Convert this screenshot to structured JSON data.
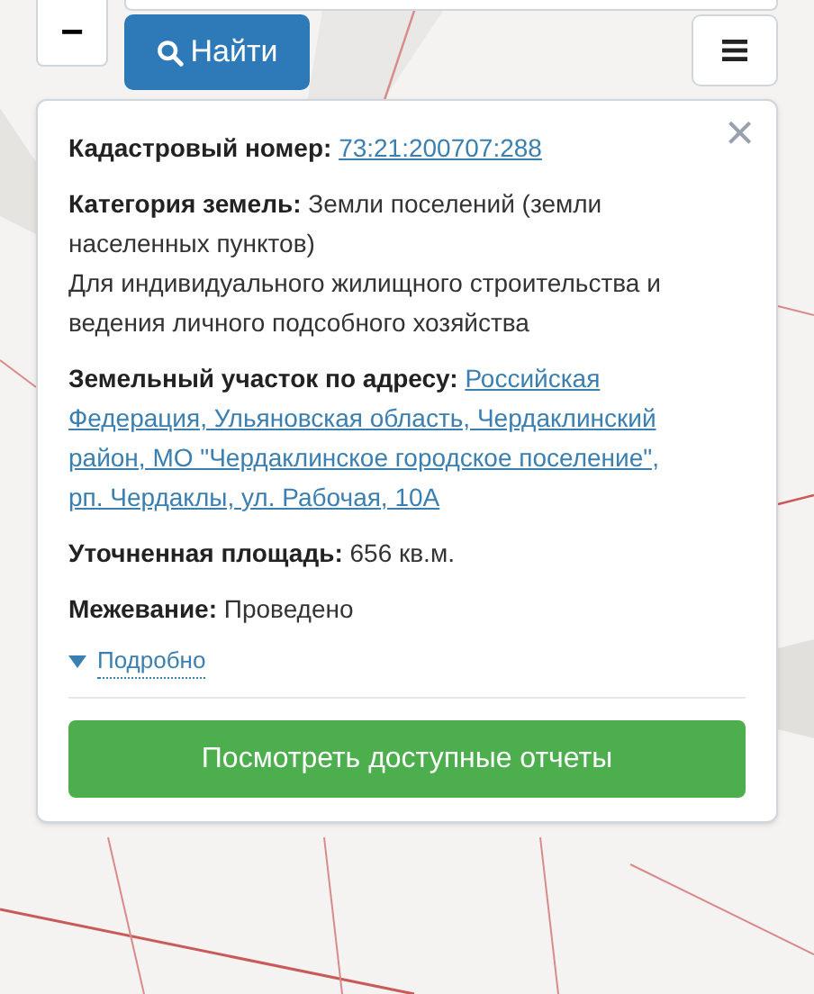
{
  "map_controls": {
    "zoom_out": "−",
    "search_button": "Найти"
  },
  "popup": {
    "close": "×",
    "fields": [
      {
        "kind": "link",
        "label": "Кадастровый номер:",
        "lines": [
          "73:21:200707:288"
        ]
      },
      {
        "kind": "text",
        "label": "Категория земель:",
        "value": "Земли поселений (земли населенных пунктов)",
        "note": "Для индивидуального жилищного строительства и ведения личного подсобного хозяйства"
      },
      {
        "kind": "link",
        "label": "Земельный участок по адресу:",
        "lines": [
          "Российская",
          "Федерация, Ульяновская область, Чердаклинский",
          "район, МО \"Чердаклинское городское поселение\",",
          "рп. Чердаклы, ул. Рабочая, 10А"
        ]
      },
      {
        "kind": "text",
        "label": "Уточненная площадь:",
        "value": "656 кв.м."
      },
      {
        "kind": "text",
        "label": "Межевание:",
        "value": "Проведено"
      }
    ],
    "details": {
      "label": "Подробно",
      "expanded": false
    },
    "action_button": "Посмотреть доступные отчеты"
  }
}
